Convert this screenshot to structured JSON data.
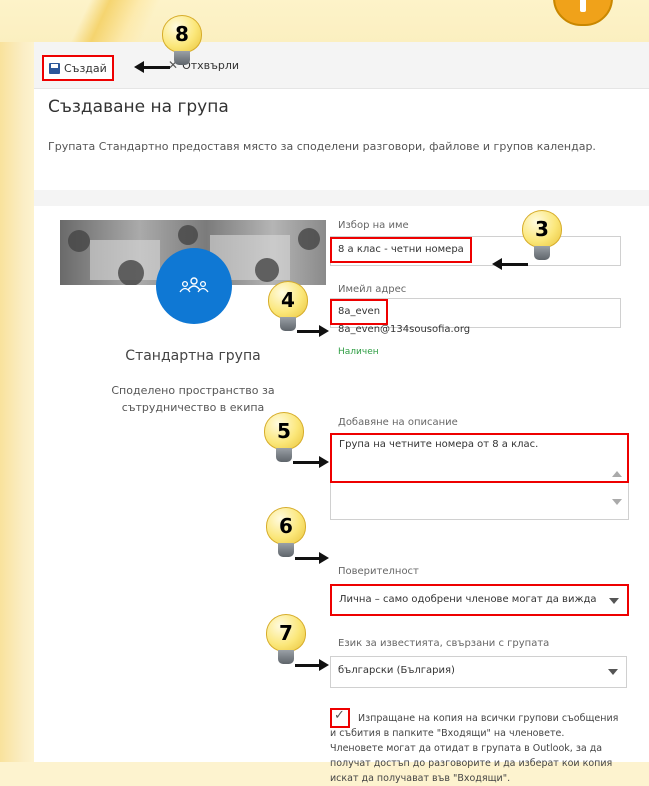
{
  "toolbar": {
    "create_label": "Създай",
    "discard_label": "Отхвърли"
  },
  "page": {
    "title": "Създаване на група",
    "description": "Групата Стандартно предоставя място за споделени разговори, файлове и групов календар."
  },
  "group_card": {
    "type_title": "Стандартна група",
    "type_desc": "Споделено пространство за сътрудничество в екипа"
  },
  "form": {
    "name_label": "Избор на име",
    "name_value": "8 а клас - четни номера",
    "email_label": "Имейл адрес",
    "email_value": "8a_even",
    "email_full": "8a_even@134sousofia.org",
    "email_status": "Наличен",
    "description_label": "Добавяне на описание",
    "description_value": "Група на четните номера от 8 а клас.",
    "privacy_label": "Поверителност",
    "privacy_value": "Лична – само одобрени членове могат да вижда",
    "language_label": "Език за известията, свързани с групата",
    "language_value": "български (България)",
    "copy_checkbox_text": "Изпращане на копия на всички групови съобщения и събития в папките \"Входящи\" на членовете. Членовете могат да отидат в групата в Outlook, за да получат достъп до разговорите и да изберат кои копия искат да получават във \"Входящи\"."
  },
  "callouts": [
    "8",
    "3",
    "4",
    "5",
    "6",
    "7"
  ],
  "colors": {
    "accent": "#0f78d4",
    "highlight": "#e00000",
    "available": "#2f9e44",
    "bulb": "#fbe77a"
  },
  "icons": [
    "save-icon",
    "close-icon",
    "group-people-icon",
    "dropdown-caret-icon",
    "checkmark-icon",
    "lightbulb-icon"
  ]
}
